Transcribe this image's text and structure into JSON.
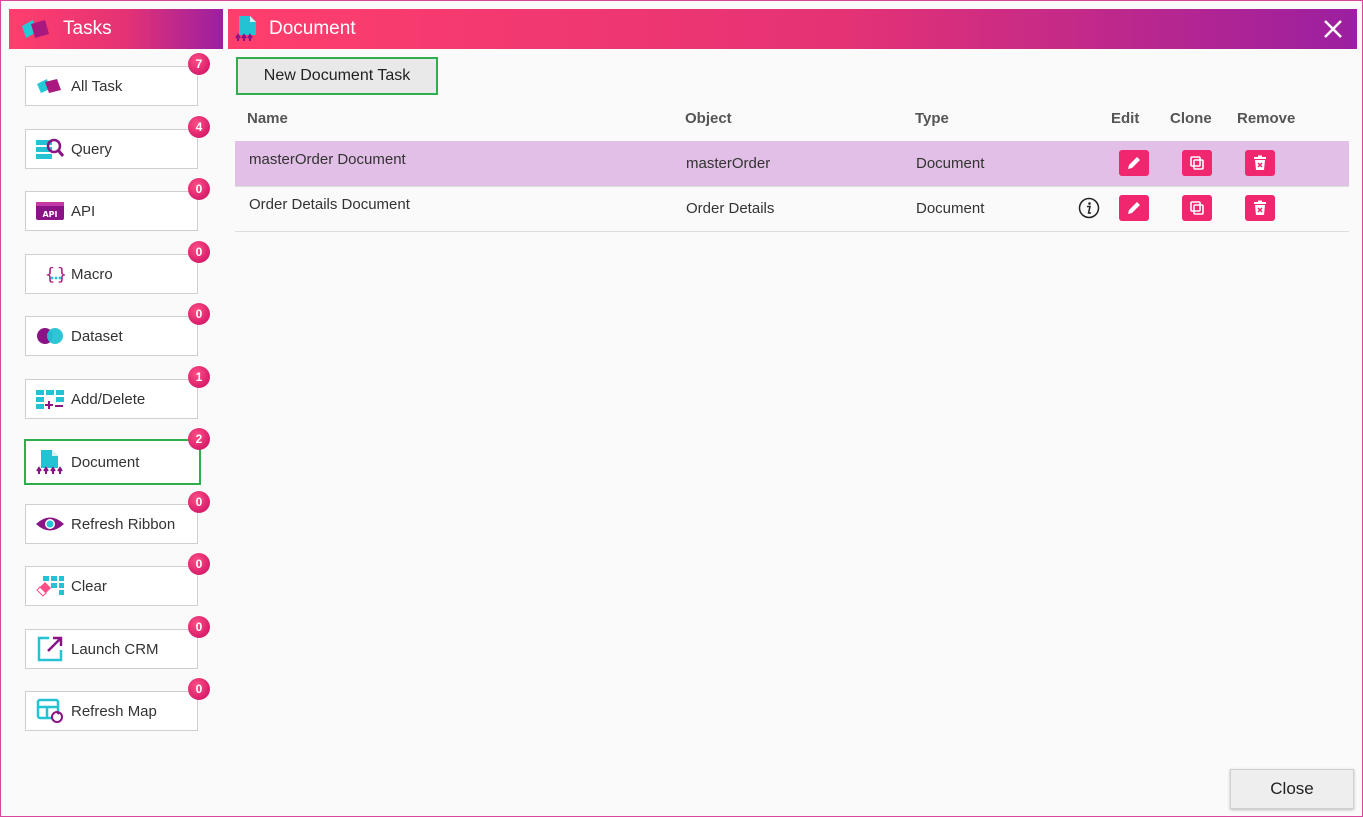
{
  "sidebar": {
    "title": "Tasks",
    "items": [
      {
        "label": "All Task",
        "count": "7",
        "icon": "all-task-icon"
      },
      {
        "label": "Query",
        "count": "4",
        "icon": "query-icon"
      },
      {
        "label": "API",
        "count": "0",
        "icon": "api-icon"
      },
      {
        "label": "Macro",
        "count": "0",
        "icon": "macro-icon"
      },
      {
        "label": "Dataset",
        "count": "0",
        "icon": "dataset-icon"
      },
      {
        "label": "Add/Delete",
        "count": "1",
        "icon": "add-delete-icon"
      },
      {
        "label": "Document",
        "count": "2",
        "icon": "document-icon"
      },
      {
        "label": "Refresh Ribbon",
        "count": "0",
        "icon": "refresh-ribbon-icon"
      },
      {
        "label": "Clear",
        "count": "0",
        "icon": "clear-icon"
      },
      {
        "label": "Launch CRM",
        "count": "0",
        "icon": "launch-crm-icon"
      },
      {
        "label": "Refresh Map",
        "count": "0",
        "icon": "refresh-map-icon"
      }
    ]
  },
  "main": {
    "title": "Document",
    "new_button": "New Document Task",
    "columns": {
      "name": "Name",
      "object": "Object",
      "type": "Type",
      "edit": "Edit",
      "clone": "Clone",
      "remove": "Remove"
    },
    "rows": [
      {
        "name": "masterOrder Document",
        "object": "masterOrder",
        "type": "Document"
      },
      {
        "name": "Order Details Document",
        "object": "Order Details",
        "type": "Document"
      }
    ]
  },
  "footer": {
    "close_label": "Close"
  },
  "colors": {
    "accent": "#f0266f",
    "gradient_start": "#ff3e6c",
    "gradient_end": "#9b1fa0",
    "selected_row": "#e2bfe6",
    "focus_border": "#2fae4d"
  }
}
